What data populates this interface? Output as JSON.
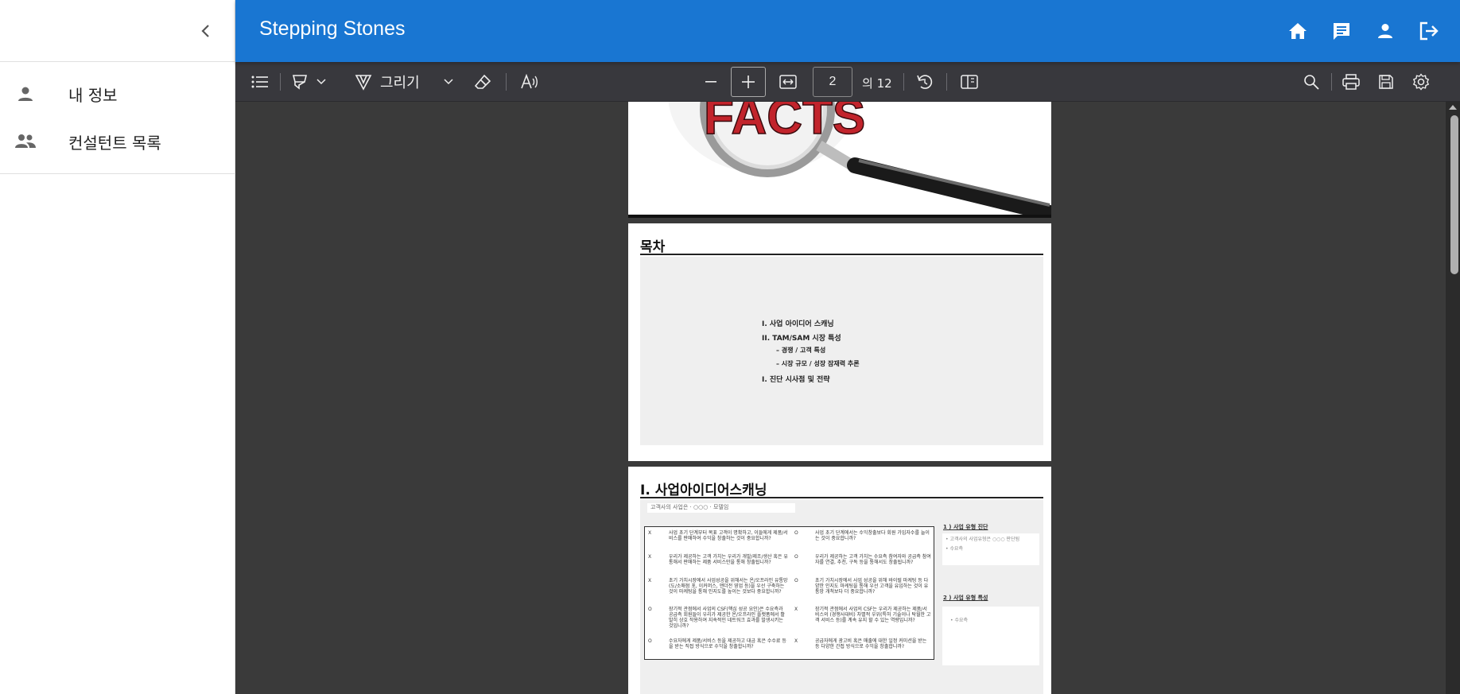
{
  "app": {
    "title": "Stepping Stones"
  },
  "sidebar": {
    "items": [
      {
        "label": "내 정보",
        "icon": "person-icon"
      },
      {
        "label": "컨설턴트 목록",
        "icon": "group-icon"
      }
    ]
  },
  "header": {
    "icons": [
      "home-icon",
      "chat-icon",
      "account-icon",
      "logout-icon"
    ]
  },
  "toolbar": {
    "draw_label": "그리기",
    "page_number": "2",
    "page_total": "의 12"
  },
  "document": {
    "page2": {
      "title": "목차",
      "toc": [
        "I.    사업   아이디어    스캐닝",
        "II.   TAM/SAM 시장 특성",
        "–   경쟁  /  고객    특성",
        "–   시장 규모 /  성장 잠재력    추론",
        "I.    진단 시사점 및    전략"
      ]
    },
    "page3": {
      "title": "I. 사업아이디어스캐닝",
      "subtitle": "고객사의    사업은      · ○○○ · 모델임",
      "side1_title": "1 ) 사업    유형    진단",
      "side1_lines": [
        "•  고객사의    사업유형은    ○○○    판단됨",
        "•  수요측"
      ],
      "side2_title": "2 ) 사업    유형    특성",
      "side2_lines": [
        "•  수요측"
      ],
      "rows": [
        {
          "l": "X",
          "ltext": "사업 초기 단계부터 목표 고객이 명확하고, 이들에게 제품/서비스를 판매하여 수익을 창출하는 것이 중요합니까?",
          "r": "O",
          "rtext": "사업 초기 단계에서는 수익창출보다 회원 가입자수를 늘이는 것이 중요합니까?"
        },
        {
          "l": "X",
          "ltext": "우리가 제공하는 고객 가치는 우리가 개발/제조/생산 혹은 유통해서 판매하는 제품 서비스만을 통해 창출됩니까?",
          "r": "O",
          "rtext": "우리가 제공하는 고객 가치는 수요측 참여자와 공급측 참여자를 연결, 추천, 구독 등을 통해서도 창출됩니까?"
        },
        {
          "l": "X",
          "ltext": "초기 가치시장에서 사업성공을 위해서는 온/오프라인 유통망(도/소매점 포, 이커머스, 앤더전 영업 등)을 우선 구축하는 것이 마케팅을 통해 인지도를 높이는 것보다 중요합니까?",
          "r": "O",
          "rtext": "초기 가치시장에서 사업 성공을 위해 바이럴 마케팅 등 다양한 인지도 마케팅을 통해 우선 고객을 유입하는 것이 유통망 개척보다 더 중요합니까?"
        },
        {
          "l": "O",
          "ltext": "장기적 관점에서 사업의 CSF(핵심 성공 요인)은 수요측과 공급측 회원들이 우리가 제공한 온/오프라인 플랫폼에서 활발히 상호 작용하여 지속적인 네트워크 효과를 발생시키는 것입니까?",
          "r": "X",
          "rtext": "장기적 관점에서 사업의 CSF는 우리가 제공하는 제품/서비스의 (경쟁사대비) 차별적 우위(특허 기술이나 탁월한 고객 서비스 등)를 계속 유지 할 수 있는 역량입니까?"
        },
        {
          "l": "O",
          "ltext": "수요자에게 제품/서비스 등을 제공하고 대금 혹은 수수료 등을 받는 직접 방식으로 수익을 창출합니까?",
          "r": "X",
          "rtext": "공급자에게 광고비 혹은 매출에 대한 일정 커미션을 받는 등 다양한 간접 방식으로 수익을 창출합니까?"
        }
      ]
    },
    "page1": {
      "image_text": "FACTS"
    }
  },
  "colors": {
    "header_bg": "#1976d2",
    "toolbar_bg": "#38383d",
    "viewer_bg": "#3a3a3a"
  }
}
